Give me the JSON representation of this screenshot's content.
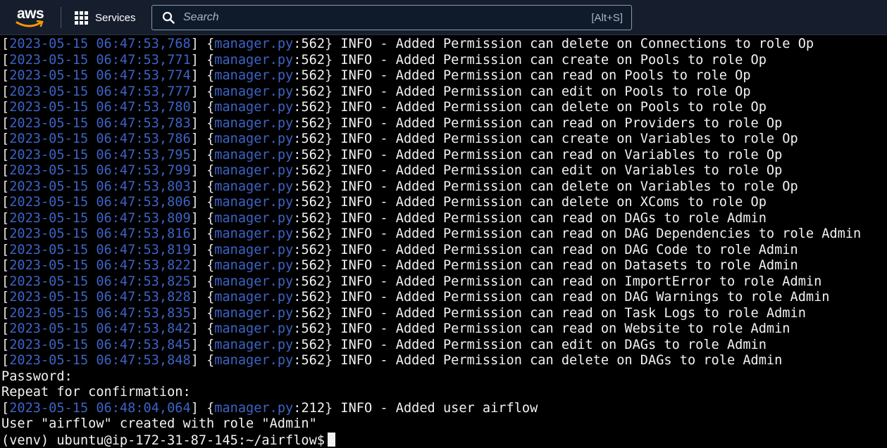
{
  "topbar": {
    "logo_text": "aws",
    "services_label": "Services",
    "search_placeholder": "Search",
    "search_shortcut": "[Alt+S]"
  },
  "terminal": {
    "log_lines": [
      {
        "ts": "2023-05-15 06:47:53,768",
        "mod": "manager.py",
        "ln": "562",
        "msg": "INFO - Added Permission can delete on Connections to role Op"
      },
      {
        "ts": "2023-05-15 06:47:53,771",
        "mod": "manager.py",
        "ln": "562",
        "msg": "INFO - Added Permission can create on Pools to role Op"
      },
      {
        "ts": "2023-05-15 06:47:53,774",
        "mod": "manager.py",
        "ln": "562",
        "msg": "INFO - Added Permission can read on Pools to role Op"
      },
      {
        "ts": "2023-05-15 06:47:53,777",
        "mod": "manager.py",
        "ln": "562",
        "msg": "INFO - Added Permission can edit on Pools to role Op"
      },
      {
        "ts": "2023-05-15 06:47:53,780",
        "mod": "manager.py",
        "ln": "562",
        "msg": "INFO - Added Permission can delete on Pools to role Op"
      },
      {
        "ts": "2023-05-15 06:47:53,783",
        "mod": "manager.py",
        "ln": "562",
        "msg": "INFO - Added Permission can read on Providers to role Op"
      },
      {
        "ts": "2023-05-15 06:47:53,786",
        "mod": "manager.py",
        "ln": "562",
        "msg": "INFO - Added Permission can create on Variables to role Op"
      },
      {
        "ts": "2023-05-15 06:47:53,795",
        "mod": "manager.py",
        "ln": "562",
        "msg": "INFO - Added Permission can read on Variables to role Op"
      },
      {
        "ts": "2023-05-15 06:47:53,799",
        "mod": "manager.py",
        "ln": "562",
        "msg": "INFO - Added Permission can edit on Variables to role Op"
      },
      {
        "ts": "2023-05-15 06:47:53,803",
        "mod": "manager.py",
        "ln": "562",
        "msg": "INFO - Added Permission can delete on Variables to role Op"
      },
      {
        "ts": "2023-05-15 06:47:53,806",
        "mod": "manager.py",
        "ln": "562",
        "msg": "INFO - Added Permission can delete on XComs to role Op"
      },
      {
        "ts": "2023-05-15 06:47:53,809",
        "mod": "manager.py",
        "ln": "562",
        "msg": "INFO - Added Permission can read on DAGs to role Admin"
      },
      {
        "ts": "2023-05-15 06:47:53,816",
        "mod": "manager.py",
        "ln": "562",
        "msg": "INFO - Added Permission can read on DAG Dependencies to role Admin"
      },
      {
        "ts": "2023-05-15 06:47:53,819",
        "mod": "manager.py",
        "ln": "562",
        "msg": "INFO - Added Permission can read on DAG Code to role Admin"
      },
      {
        "ts": "2023-05-15 06:47:53,822",
        "mod": "manager.py",
        "ln": "562",
        "msg": "INFO - Added Permission can read on Datasets to role Admin"
      },
      {
        "ts": "2023-05-15 06:47:53,825",
        "mod": "manager.py",
        "ln": "562",
        "msg": "INFO - Added Permission can read on ImportError to role Admin"
      },
      {
        "ts": "2023-05-15 06:47:53,828",
        "mod": "manager.py",
        "ln": "562",
        "msg": "INFO - Added Permission can read on DAG Warnings to role Admin"
      },
      {
        "ts": "2023-05-15 06:47:53,835",
        "mod": "manager.py",
        "ln": "562",
        "msg": "INFO - Added Permission can read on Task Logs to role Admin"
      },
      {
        "ts": "2023-05-15 06:47:53,842",
        "mod": "manager.py",
        "ln": "562",
        "msg": "INFO - Added Permission can read on Website to role Admin"
      },
      {
        "ts": "2023-05-15 06:47:53,845",
        "mod": "manager.py",
        "ln": "562",
        "msg": "INFO - Added Permission can edit on DAGs to role Admin"
      },
      {
        "ts": "2023-05-15 06:47:53,848",
        "mod": "manager.py",
        "ln": "562",
        "msg": "INFO - Added Permission can delete on DAGs to role Admin"
      }
    ],
    "password_prompt": "Password:",
    "repeat_prompt": "Repeat for confirmation:",
    "user_added_line": {
      "ts": "2023-05-15 06:48:04,064",
      "mod": "manager.py",
      "ln": "212",
      "msg": "INFO - Added user airflow"
    },
    "created_line": "User \"airflow\" created with role \"Admin\"",
    "shell_prompt": "(venv) ubuntu@ip-172-31-87-145:~/airflow$"
  },
  "colors": {
    "topbar_bg": "#161e2d",
    "terminal_bg": "#000000",
    "log_blue": "#3c63c6",
    "text": "#f2f2f2",
    "aws_smile": "#ff9900"
  }
}
